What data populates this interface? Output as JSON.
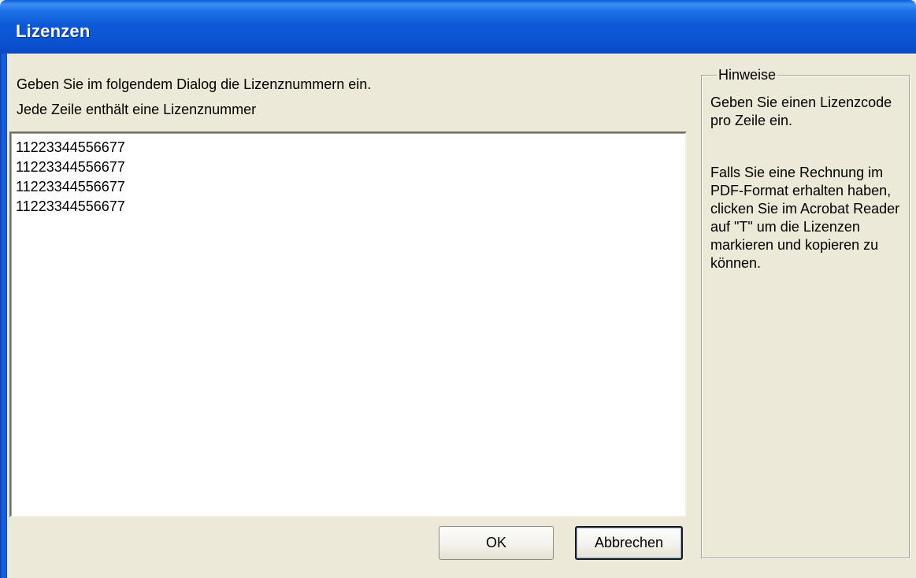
{
  "window": {
    "title": "Lizenzen"
  },
  "instructions": {
    "line1": "Geben Sie im folgendem Dialog die Lizenznummern ein.",
    "line2": "Jede Zeile enthält eine Lizenznummer"
  },
  "license_input": {
    "lines": [
      "11223344556677",
      "11223344556677",
      "11223344556677",
      "11223344556677"
    ]
  },
  "buttons": {
    "ok_label": "OK",
    "cancel_label": "Abbrechen"
  },
  "hints": {
    "legend": "Hinweise",
    "paragraph1": "Geben Sie einen Lizenzcode pro Zeile ein.",
    "paragraph2": "Falls Sie eine Rechnung im PDF-Format erhalten haben, clicken Sie im Acrobat Reader auf \"T\" um die Lizenzen markieren und kopieren zu können."
  },
  "colors": {
    "titlebar": "#0c5ad8",
    "dialog_background": "#ece9d8",
    "default_button_border": "#1a1a1a"
  }
}
